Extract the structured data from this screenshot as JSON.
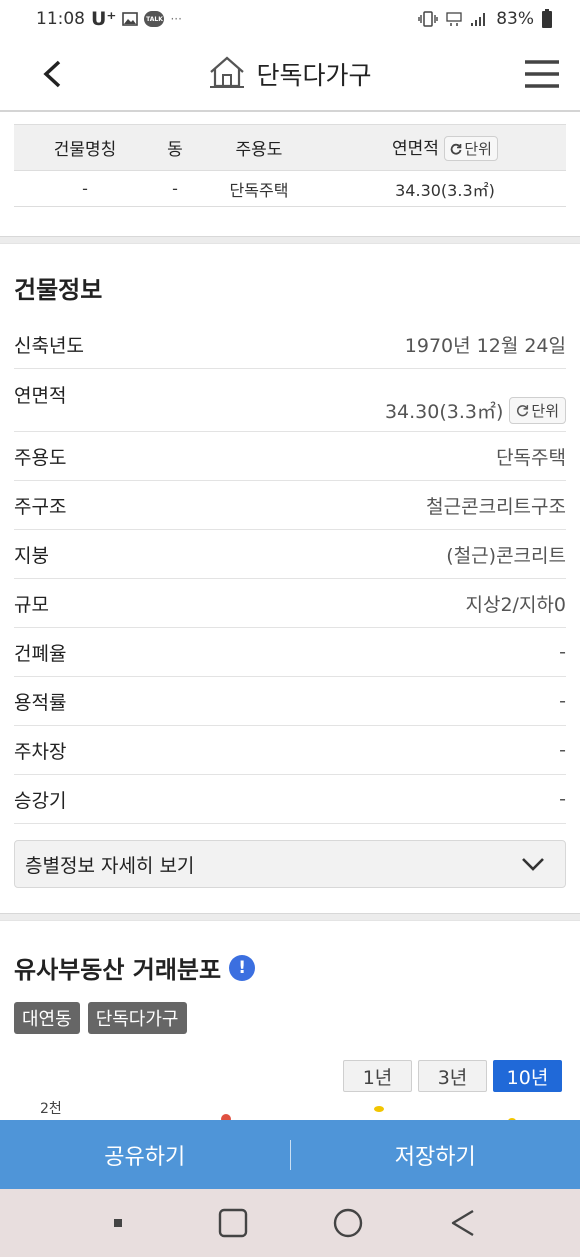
{
  "status_bar": {
    "time": "11:08",
    "carrier": "U⁺",
    "talk_label": "TALK",
    "dots": "···",
    "battery": "83%"
  },
  "header": {
    "title": "단독다가구"
  },
  "summary": {
    "headers": [
      "건물명칭",
      "동",
      "주용도",
      "연면적"
    ],
    "unit_label": "단위",
    "row": [
      "-",
      "-",
      "단독주택",
      "34.30(3.3㎡)"
    ]
  },
  "building_info": {
    "title": "건물정보",
    "rows": [
      {
        "label": "신축년도",
        "value": "1970년 12월 24일"
      },
      {
        "label": "연면적",
        "value": "34.30(3.3㎡)"
      },
      {
        "label": "주용도",
        "value": "단독주택"
      },
      {
        "label": "주구조",
        "value": "철근콘크리트구조"
      },
      {
        "label": "지붕",
        "value": "(철근)콘크리트"
      },
      {
        "label": "규모",
        "value": "지상2/지하0"
      },
      {
        "label": "건폐율",
        "value": "-"
      },
      {
        "label": "용적률",
        "value": "-"
      },
      {
        "label": "주차장",
        "value": "-"
      },
      {
        "label": "승강기",
        "value": "-"
      }
    ],
    "unit_label": "단위",
    "floor_detail_label": "층별정보 자세히 보기"
  },
  "distribution": {
    "title": "유사부동산 거래분포",
    "info_mark": "!",
    "tags": [
      "대연동",
      "단독다가구"
    ],
    "periods": [
      "1년",
      "3년",
      "10년"
    ],
    "active_period": "10년",
    "axis_top_label": "2천"
  },
  "actions": {
    "share": "공유하기",
    "save": "저장하기"
  },
  "colors": {
    "action_bar": "#4f95d8",
    "active_period": "#2069d8",
    "info_badge": "#3b6fe0",
    "tag_bg": "#666666"
  }
}
